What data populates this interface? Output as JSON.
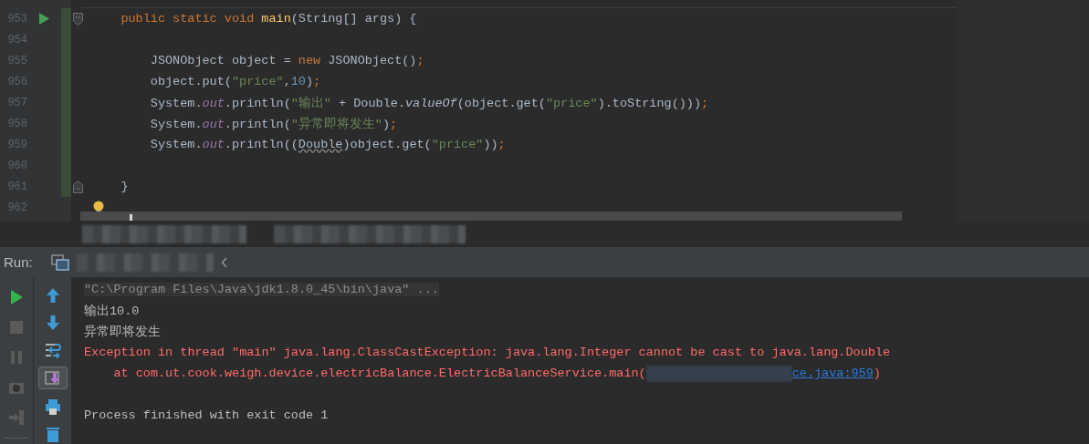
{
  "editor": {
    "lines": [
      {
        "number": "953",
        "run_marker": true,
        "fold_open": true,
        "tokens": [
          {
            "text": "    public static void ",
            "kind": "keyword"
          },
          {
            "text": "main",
            "kind": "method"
          },
          {
            "text": "(String[] args) {"
          }
        ]
      },
      {
        "number": "954"
      },
      {
        "number": "955",
        "tokens": [
          {
            "text": "        JSONObject object = "
          },
          {
            "text": "new ",
            "kind": "keyword"
          },
          {
            "text": "JSONObject()"
          },
          {
            "text": ";",
            "kind": "keyword"
          }
        ]
      },
      {
        "number": "956",
        "tokens": [
          {
            "text": "        object.put("
          },
          {
            "text": "\"price\"",
            "kind": "string"
          },
          {
            "text": ","
          },
          {
            "text": "10",
            "kind": "number"
          },
          {
            "text": ")"
          },
          {
            "text": ";",
            "kind": "keyword"
          }
        ]
      },
      {
        "number": "957",
        "tokens": [
          {
            "text": "        System."
          },
          {
            "text": "out",
            "kind": "field"
          },
          {
            "text": ".println("
          },
          {
            "text": "\"输出\"",
            "kind": "string"
          },
          {
            "text": " + Double."
          },
          {
            "text": "valueOf",
            "kind": "static"
          },
          {
            "text": "(object.get("
          },
          {
            "text": "\"price\"",
            "kind": "string"
          },
          {
            "text": ").toString()))"
          },
          {
            "text": ";",
            "kind": "keyword"
          }
        ]
      },
      {
        "number": "958",
        "tokens": [
          {
            "text": "        System."
          },
          {
            "text": "out",
            "kind": "field"
          },
          {
            "text": ".println("
          },
          {
            "text": "\"异常即将发生\"",
            "kind": "string"
          },
          {
            "text": ")"
          },
          {
            "text": ";",
            "kind": "keyword"
          }
        ]
      },
      {
        "number": "959",
        "tokens": [
          {
            "text": "        System."
          },
          {
            "text": "out",
            "kind": "field"
          },
          {
            "text": ".println(("
          },
          {
            "text": "Double",
            "kind": "warning"
          },
          {
            "text": ")object.get("
          },
          {
            "text": "\"price\"",
            "kind": "string"
          },
          {
            "text": "))"
          },
          {
            "text": ";",
            "kind": "keyword"
          }
        ]
      },
      {
        "number": "960"
      },
      {
        "number": "961",
        "fold_close": true,
        "tokens": [
          {
            "text": "    }"
          }
        ]
      },
      {
        "number": "962",
        "bulb": true
      }
    ]
  },
  "run_panel": {
    "label": "Run:",
    "left_tools": [
      {
        "kind": "run",
        "disabled": false
      },
      {
        "kind": "stop",
        "disabled": true
      },
      {
        "kind": "pause",
        "disabled": true
      },
      {
        "kind": "camera",
        "disabled": true
      },
      {
        "kind": "exit",
        "disabled": true
      }
    ],
    "right_tools": [
      {
        "kind": "up",
        "selected": false
      },
      {
        "kind": "down",
        "selected": false
      },
      {
        "kind": "wrap",
        "selected": false
      },
      {
        "kind": "scroll-end",
        "selected": true
      },
      {
        "kind": "print",
        "selected": false
      },
      {
        "kind": "trash",
        "selected": false
      }
    ],
    "console": [
      {
        "kind": "command",
        "text": "\"C:\\Program Files\\Java\\jdk1.8.0_45\\bin\\java\" ..."
      },
      {
        "kind": "output",
        "text": "输出10.0"
      },
      {
        "kind": "output",
        "text": "异常即将发生"
      },
      {
        "kind": "error",
        "text": "Exception in thread \"main\" java.lang.ClassCastException: java.lang.Integer cannot be cast to java.lang.Double"
      },
      {
        "kind": "trace",
        "text": "    at com.ut.cook.weigh.device.electricBalance.ElectricBalanceService.main(",
        "link": "ce.java:959",
        "tail": ")"
      },
      {
        "kind": "blank"
      },
      {
        "kind": "output",
        "text": "Process finished with exit code 1"
      }
    ]
  }
}
